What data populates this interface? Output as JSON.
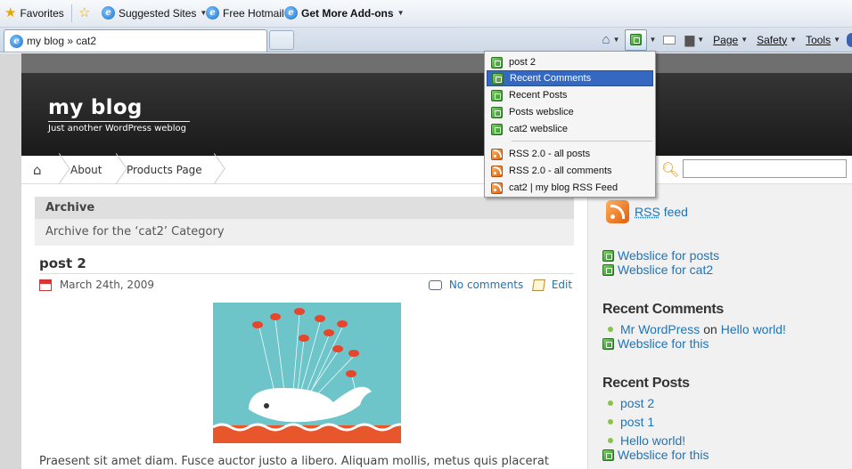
{
  "browser": {
    "favorites_bar": {
      "favorites_label": "Favorites",
      "items": [
        "Suggested Sites",
        "Free Hotmail",
        "Get More Add-ons"
      ]
    },
    "tab": {
      "title": "my blog » cat2"
    },
    "command_bar": {
      "page_label": "Page",
      "safety_label": "Safety",
      "tools_label": "Tools"
    },
    "feed_menu": {
      "webslices": [
        "post 2",
        "Recent Comments",
        "Recent Posts",
        "Posts webslice",
        "cat2 webslice"
      ],
      "feeds": [
        "RSS 2.0 - all posts",
        "RSS 2.0 - all comments",
        "cat2 | my blog RSS Feed"
      ],
      "selected": "Recent Comments"
    }
  },
  "blog": {
    "title": "my blog",
    "tagline": "Just another WordPress weblog",
    "nav": [
      "About",
      "Products Page"
    ],
    "archive": {
      "heading": "Archive",
      "subheading": "Archive for the ‘cat2’ Category"
    },
    "post": {
      "title": "post 2",
      "date": "March 24th, 2009",
      "comments": "No comments",
      "edit": "Edit",
      "excerpt": "Praesent sit amet diam. Fusce auctor justo a libero. Aliquam mollis, metus quis placerat"
    },
    "sidebar": {
      "rss_word": "RSS",
      "rss_feed_text": "feed",
      "webslice_posts": "Webslice for posts",
      "webslice_cat2": "Webslice for cat2",
      "recent_comments": {
        "heading": "Recent Comments",
        "author": "Mr WordPress",
        "on": "on",
        "target": "Hello world!",
        "webslice": "Webslice for this"
      },
      "recent_posts": {
        "heading": "Recent Posts",
        "items": [
          "post 2",
          "post 1",
          "Hello world!"
        ],
        "webslice": "Webslice for this"
      }
    }
  }
}
